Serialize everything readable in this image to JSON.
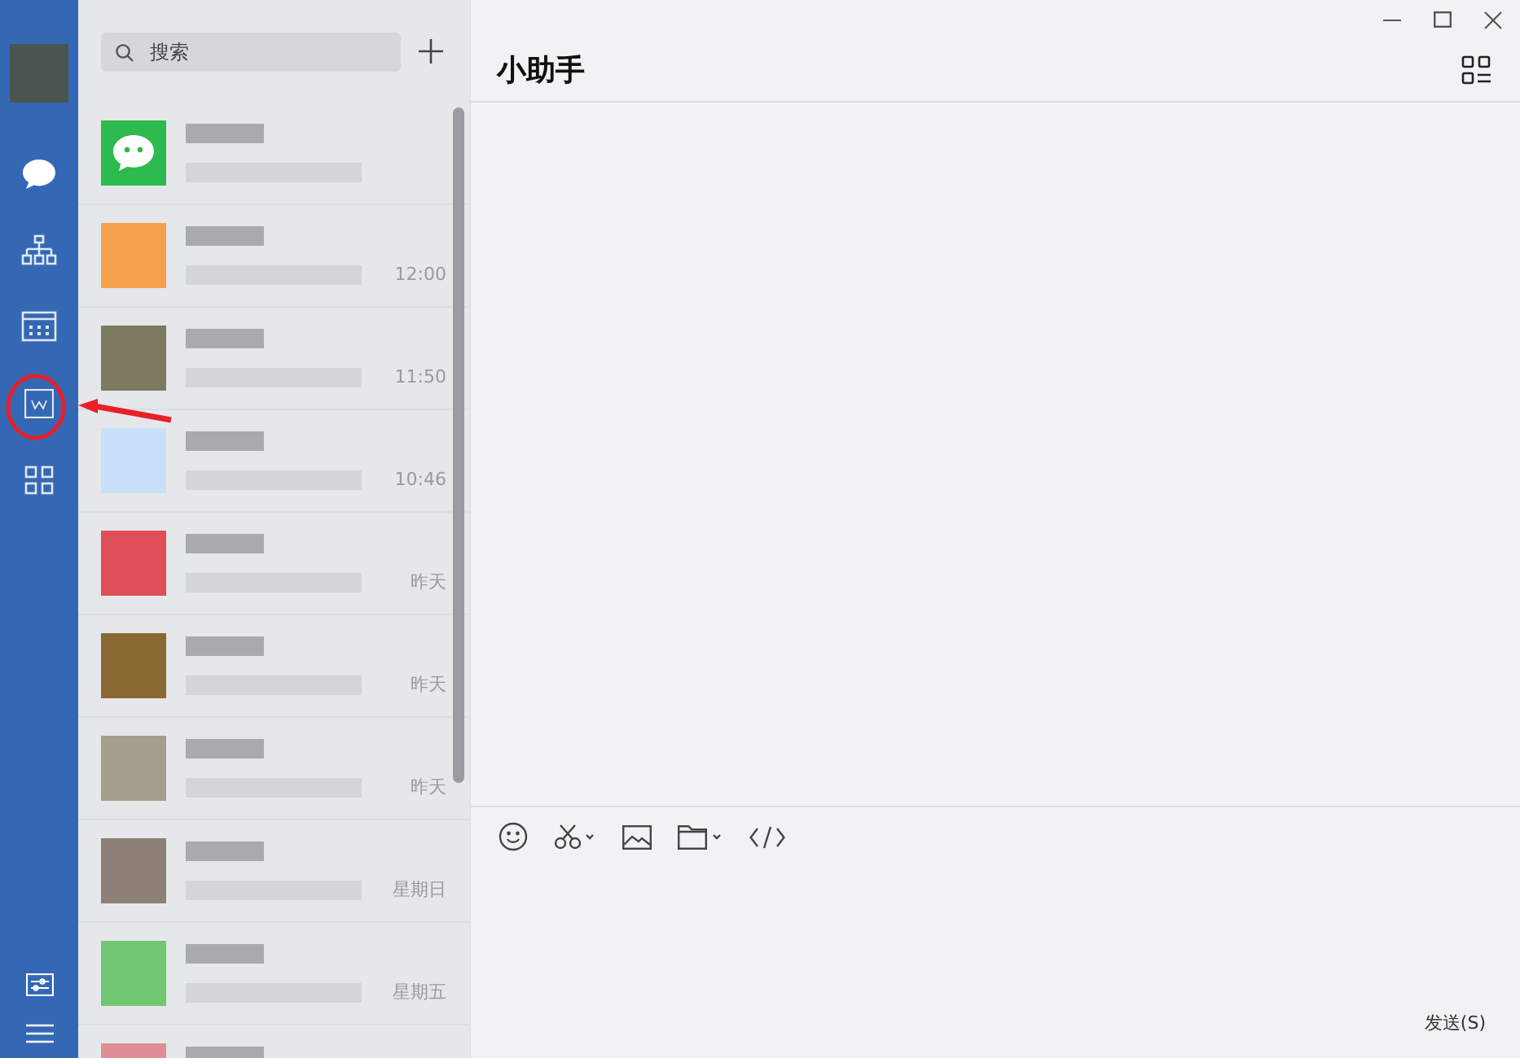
{
  "sidebar": {
    "items": [
      {
        "kind": "chat",
        "selected": true
      },
      {
        "kind": "org",
        "selected": false
      },
      {
        "kind": "calendar",
        "selected": false
      },
      {
        "kind": "doc",
        "selected": false
      },
      {
        "kind": "apps",
        "selected": false
      }
    ],
    "bottom": [
      {
        "kind": "settings"
      },
      {
        "kind": "menu"
      }
    ]
  },
  "search": {
    "placeholder": "搜索"
  },
  "chats": [
    {
      "kind": "logo",
      "color": "#2dba4e"
    },
    {
      "kind": "blurred",
      "color": "#f5a04a",
      "time": "12:00"
    },
    {
      "kind": "blurred",
      "color": "#7d7a60",
      "time": "11:50"
    },
    {
      "kind": "blurred",
      "color": "#c7e0f7",
      "time": "10:46"
    },
    {
      "kind": "blurred",
      "color": "#de4f58",
      "time": "昨天"
    },
    {
      "kind": "blurred",
      "color": "#8a6a32",
      "time": "昨天"
    },
    {
      "kind": "blurred",
      "color": "#a49e8a",
      "time": "昨天"
    },
    {
      "kind": "blurred",
      "color": "#8c8078",
      "time": "星期日"
    },
    {
      "kind": "blurred",
      "color": "#72c872",
      "time": "星期五"
    },
    {
      "kind": "blurred",
      "color": "#de8e94"
    }
  ],
  "conversation": {
    "title": "小助手"
  },
  "toolbar": [
    {
      "kind": "emoji"
    },
    {
      "kind": "screenshot"
    },
    {
      "kind": "image"
    },
    {
      "kind": "folder"
    },
    {
      "kind": "code"
    }
  ],
  "send_button": "发送(S)"
}
